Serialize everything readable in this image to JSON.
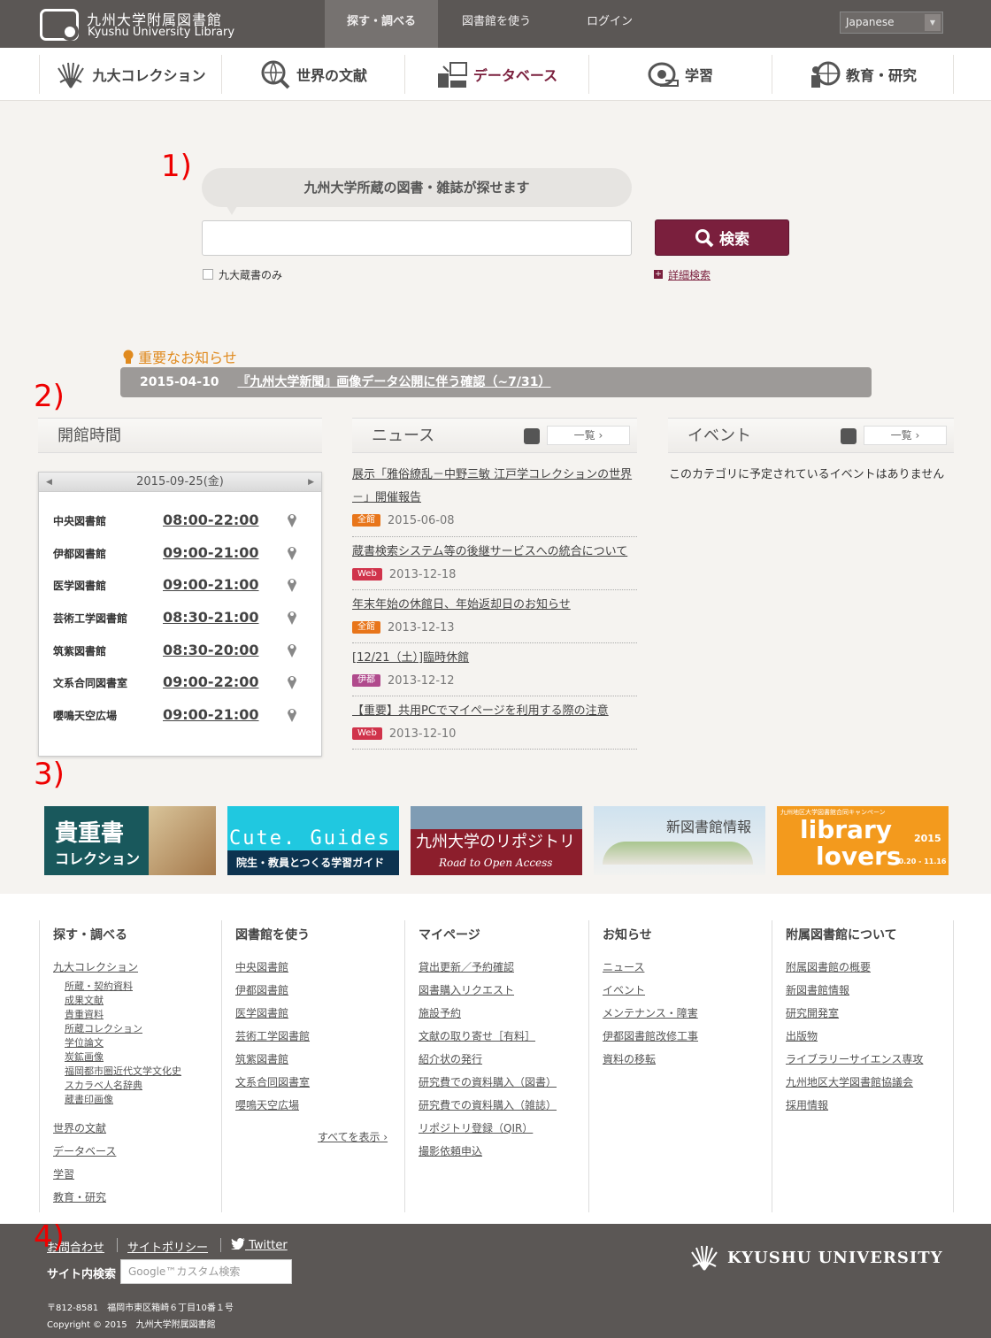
{
  "header": {
    "logo_jp": "九州大学附属図書館",
    "logo_en": "Kyushu University Library",
    "nav": [
      "探す・調べる",
      "図書館を使う",
      "ログイン"
    ],
    "language": "Japanese"
  },
  "categories": [
    {
      "label": "九大コレクション",
      "icon": "fan-icon"
    },
    {
      "label": "世界の文献",
      "icon": "globe-search-icon"
    },
    {
      "label": "データベース",
      "icon": "database-icon"
    },
    {
      "label": "学習",
      "icon": "study-icon"
    },
    {
      "label": "教育・研究",
      "icon": "research-icon"
    }
  ],
  "annotations": [
    "1)",
    "2)",
    "3)",
    "4)"
  ],
  "search": {
    "heading": "九州大学所蔵の図書・雑誌が探せます",
    "button": "検索",
    "checkbox_label": "九大蔵書のみ",
    "advanced": "詳細検索"
  },
  "notice": {
    "heading": "重要なお知らせ",
    "date": "2015-04-10",
    "text": "『九州大学新聞』画像データ公開に伴う確認（~7/31）"
  },
  "hours": {
    "heading": "開館時間",
    "date": "2015-09-25(金)",
    "rows": [
      {
        "name": "中央図書館",
        "time": "08:00-22:00"
      },
      {
        "name": "伊都図書館",
        "time": "09:00-21:00"
      },
      {
        "name": "医学図書館",
        "time": "09:00-21:00"
      },
      {
        "name": "芸術工学図書館",
        "time": "08:30-21:00"
      },
      {
        "name": "筑紫図書館",
        "time": "08:30-20:00"
      },
      {
        "name": "文系合同図書室",
        "time": "09:00-22:00"
      },
      {
        "name": "嚶鳴天空広場",
        "time": "09:00-21:00"
      }
    ]
  },
  "news": {
    "heading": "ニュース",
    "list_label": "一覧",
    "items": [
      {
        "title": "展示「雅俗繚乱－中野三敏 江戸学コレクションの世界－」開催報告",
        "tag": "全館",
        "tag_color": "#e8751a",
        "date": "2015-06-08"
      },
      {
        "title": "蔵書検索システム等の後継サービスへの統合について",
        "tag": "Web",
        "tag_color": "#d0334b",
        "date": "2013-12-18"
      },
      {
        "title": "年末年始の休館日、年始返却日のお知らせ",
        "tag": "全館",
        "tag_color": "#e8751a",
        "date": "2013-12-13"
      },
      {
        "title": "[12/21（土）]臨時休館",
        "tag": "伊都",
        "tag_color": "#b04a8c",
        "date": "2013-12-12"
      },
      {
        "title": "【重要】共用PCでマイページを利用する際の注意",
        "tag": "Web",
        "tag_color": "#d0334b",
        "date": "2013-12-10"
      }
    ]
  },
  "events": {
    "heading": "イベント",
    "list_label": "一覧",
    "empty": "このカテゴリに予定されているイベントはありません"
  },
  "banners": {
    "b1_line1": "貴重書",
    "b1_line2": "コレクション",
    "b2_line1": "Cute. Guides",
    "b2_line2": "院生・教員とつくる学習ガイド",
    "b3_line1": "九州大学のリポジトリ",
    "b3_line2": "Road to Open Access",
    "b4_line1": "新図書館情報",
    "b5_top": "九州地区大学図書館合同キャンペーン",
    "b5_line1": "library",
    "b5_line2": "lovers",
    "b5_year": "2015",
    "b5_dates": "10.20 - 11.16"
  },
  "footer_map": {
    "col1": {
      "heading": "探す・調べる",
      "top_link": "九大コレクション",
      "subs": [
        "所蔵・契約資料",
        "成果文献",
        "貴重資料",
        "所蔵コレクション",
        "学位論文",
        "炭鉱画像",
        "福岡都市圏近代文学文化史",
        "スカラベ人名辞典",
        "蔵書印画像"
      ],
      "links": [
        "世界の文献",
        "データベース",
        "学習",
        "教育・研究"
      ]
    },
    "col2": {
      "heading": "図書館を使う",
      "links": [
        "中央図書館",
        "伊都図書館",
        "医学図書館",
        "芸術工学図書館",
        "筑紫図書館",
        "文系合同図書室",
        "嚶鳴天空広場"
      ],
      "more": "すべてを表示"
    },
    "col3": {
      "heading": "マイページ",
      "links": [
        "貸出更新／予約確認",
        "図書購入リクエスト",
        "施設予約",
        "文献の取り寄せ［有料］",
        "紹介状の発行",
        "研究費での資料購入（図書）",
        "研究費での資料購入（雑誌）",
        "リポジトリ登録（QIR）",
        "撮影依頼申込"
      ]
    },
    "col4": {
      "heading": "お知らせ",
      "links": [
        "ニュース",
        "イベント",
        "メンテナンス・障害",
        "伊都図書館改修工事",
        "資料の移転"
      ]
    },
    "col5": {
      "heading": "附属図書館について",
      "links": [
        "附属図書館の概要",
        "新図書館情報",
        "研究開発室",
        "出版物",
        "ライブラリーサイエンス専攻",
        "九州地区大学図書館協議会",
        "採用情報"
      ]
    }
  },
  "bottom": {
    "links": [
      "お問合わせ",
      "サイトポリシー",
      "Twitter"
    ],
    "site_search_label": "サイト内検索",
    "site_search_placeholder": "Google™カスタム検索",
    "address": "〒812-8581　福岡市東区箱崎６丁目10番１号",
    "copyright": "Copyright © 2015　九州大学附属図書館",
    "university": "KYUSHU UNIVERSITY"
  }
}
